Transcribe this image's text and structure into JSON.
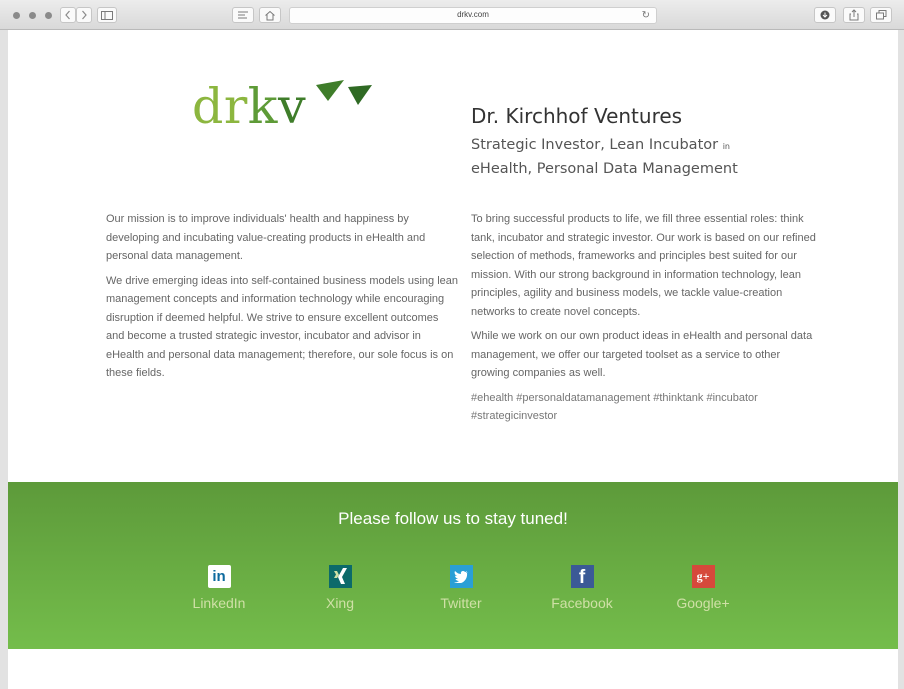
{
  "browser": {
    "url": "drkv.com"
  },
  "logo": {
    "text": "drkv",
    "colors": {
      "d": "#8cb63f",
      "k": "#5e9b37",
      "v": "#3f7d2a"
    }
  },
  "header": {
    "company_name": "Dr. Kirchhof Ventures",
    "tagline_line1": "Strategic Investor, Lean Incubator",
    "tagline_in": "in",
    "tagline_line2": "eHealth, Personal Data Management"
  },
  "content": {
    "left": [
      "Our mission is to improve individuals' health and happiness by developing and incubating value-creating products in eHealth and personal data management.",
      "We drive emerging ideas into self-contained business models using lean management concepts and information technology while encouraging disruption if deemed helpful. We strive to ensure excellent outcomes and become a trusted strategic investor, incubator and advisor in eHealth and personal data management; therefore, our sole focus is on these fields."
    ],
    "right": [
      "To bring successful products to life, we fill three essential roles: think tank, incubator and strategic investor. Our work is based on our refined selection of methods, frameworks and principles best suited for our mission. With our strong background in information technology, lean principles, agility and business models, we tackle value-creation networks to create novel concepts.",
      "While we work on our own product ideas in eHealth and personal data management, we offer our targeted toolset as a service to other growing companies as well."
    ],
    "hashtags": "#ehealth #personaldatamanagement #thinktank #incubator #strategicinvestor"
  },
  "follow": {
    "title": "Please follow us to stay tuned!",
    "links": [
      {
        "label": "LinkedIn",
        "icon": "linkedin-icon",
        "glyph": "in",
        "color": "#0e6a9e"
      },
      {
        "label": "Xing",
        "icon": "xing-icon",
        "glyph": "X",
        "color": "#ffffff"
      },
      {
        "label": "Twitter",
        "icon": "twitter-icon",
        "glyph": "t",
        "color": "#2a9fd6"
      },
      {
        "label": "Facebook",
        "icon": "facebook-icon",
        "glyph": "f",
        "color": "#3b5a96"
      },
      {
        "label": "Google+",
        "icon": "google-plus-icon",
        "glyph": "g+",
        "color": "#d6493b"
      }
    ]
  }
}
